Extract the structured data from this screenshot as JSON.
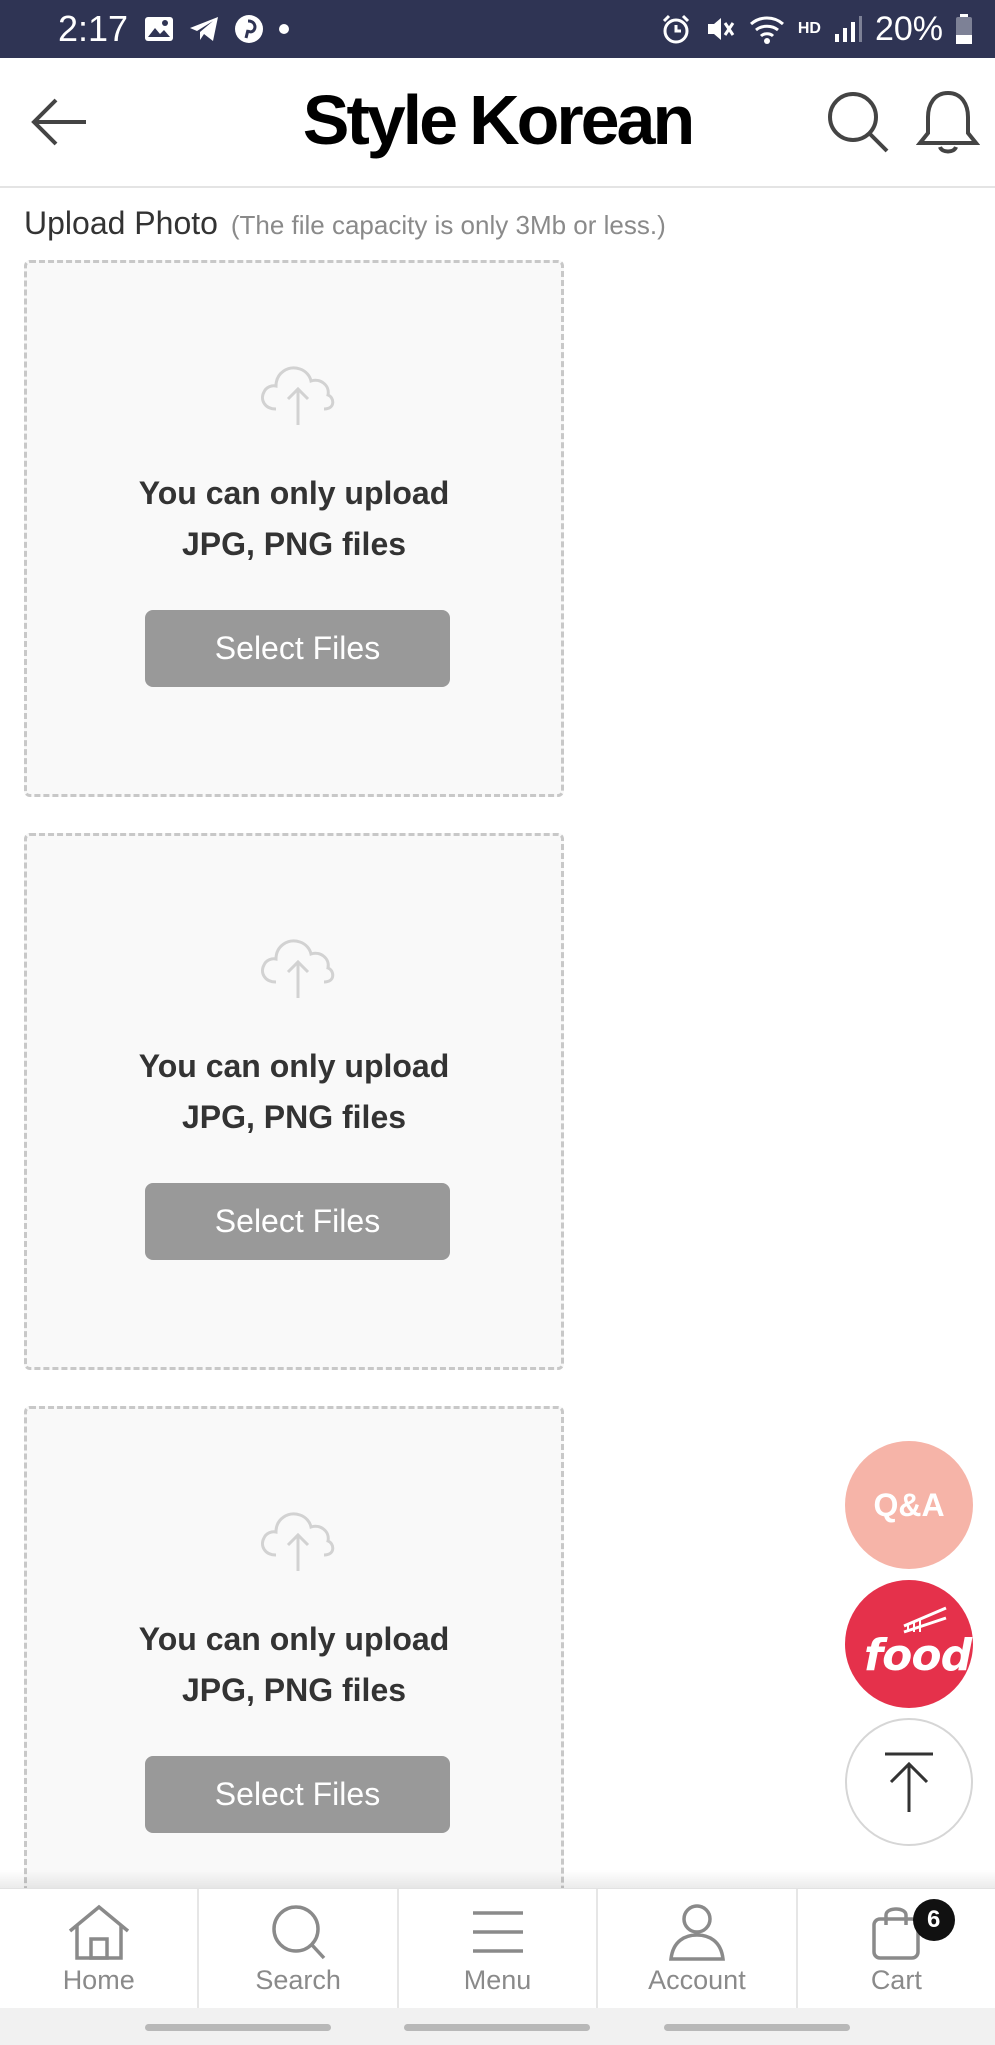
{
  "status_bar": {
    "time": "2:17",
    "battery": "20%",
    "network": "HD"
  },
  "header": {
    "brand_part1": "Style",
    "brand_part2": "Korean"
  },
  "upload": {
    "title": "Upload Photo",
    "note": "(The file capacity is only 3Mb or less.)",
    "boxes": [
      {
        "line1": "You can only upload",
        "line2": "JPG, PNG files",
        "button": "Select Files"
      },
      {
        "line1": "You can only upload",
        "line2": "JPG, PNG files",
        "button": "Select Files"
      },
      {
        "line1": "You can only upload",
        "line2": "JPG, PNG files",
        "button": "Select Files"
      }
    ]
  },
  "fab": {
    "qa": "Q&A",
    "food": "food"
  },
  "nav": {
    "items": [
      {
        "label": "Home",
        "icon": "home-icon"
      },
      {
        "label": "Search",
        "icon": "search-icon"
      },
      {
        "label": "Menu",
        "icon": "menu-icon"
      },
      {
        "label": "Account",
        "icon": "account-icon"
      },
      {
        "label": "Cart",
        "icon": "cart-icon"
      }
    ],
    "cart_count": "6"
  },
  "colors": {
    "status_bar": "#2f3454",
    "qa": "#f6b4a8",
    "food": "#e5314b",
    "button": "#999999"
  }
}
